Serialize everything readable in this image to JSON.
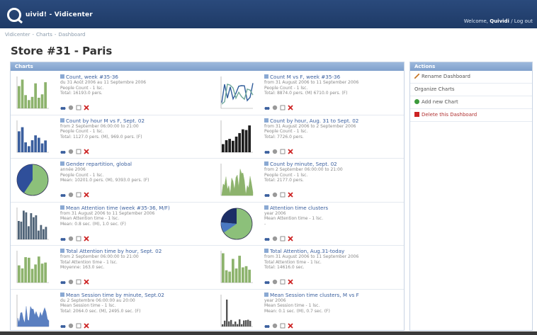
{
  "header": {
    "logo_text": "uivid! - Vidicenter",
    "welcome_prefix": "Welcome,",
    "user": "Quividi",
    "separator": "/",
    "logout": "Log out"
  },
  "breadcrumb": [
    "Vidicenter",
    "Charts",
    "Dashboard"
  ],
  "page_title": "Store #31 - Paris",
  "charts_panel": {
    "title": "Charts",
    "charts": [
      {
        "title": "Count, week #35-36",
        "lines": [
          "du 31 Août 2006 au 11 Septembre 2006",
          "People Count - 1 lsc.",
          "Total: 16193.0 pers."
        ],
        "thumb": "bar-green"
      },
      {
        "title": "Count M vs F, week #35-36",
        "lines": [
          "from 31 August 2006 to 11 September 2006",
          "People Count - 1 lsc.",
          "Total: 8874.0 pers. (M) 6710.0 pers. (F)"
        ],
        "thumb": "line-compare"
      },
      {
        "title": "Count by hour M vs F, Sept. 02",
        "lines": [
          "from 2 September 06:00:00 to 21:00",
          "People Count - 1 lsc.",
          "Total: 1127.0 pers. (M), 969.0 pers. (F)"
        ],
        "thumb": "bar-blue"
      },
      {
        "title": "Count by hour, Aug. 31 to Sept. 02",
        "lines": [
          "from 31 August 2006 to 2 September 2006",
          "People Count - 1 lsc.",
          "Total: 7726.0 pers."
        ],
        "thumb": "bar-dark"
      },
      {
        "title": "Gender repartition, global",
        "lines": [
          "année 2006",
          "People Count - 1 lsc.",
          "Mean: 10201.0 pers. (M), 9393.0 pers. (F)"
        ],
        "thumb": "pie-gender"
      },
      {
        "title": "Count by minute, Sept. 02",
        "lines": [
          "from 2 September 06:00:00 to 21:00",
          "People Count - 1 lsc.",
          "Total: 2177.0 pers."
        ],
        "thumb": "area-green"
      },
      {
        "title": "Mean Attention time (week #35-36, M/F)",
        "lines": [
          "from 31 August 2006 to 11 September 2006",
          "Mean Attention time - 1 lsc.",
          "Mean: 0.8 sec. (M), 1.0 sec. (F)"
        ],
        "thumb": "bar-slate"
      },
      {
        "title": "Attention time clusters",
        "lines": [
          "year 2006",
          "Mean Attention time - 1 lsc.",
          "-"
        ],
        "thumb": "pie-clusters"
      },
      {
        "title": "Total Attention time by hour, Sept. 02",
        "lines": [
          "from 2 September 06:00:00 to 21:00",
          "Total Attention time - 1 lsc.",
          "Moyenne: 163.0 sec."
        ],
        "thumb": "bar-green2"
      },
      {
        "title": "Total Attention, Aug.31-today",
        "lines": [
          "from 31 August 2006 to 11 September 2006",
          "Total Attention time - 1 lsc.",
          "Total: 14616.0 sec."
        ],
        "thumb": "bar-green3"
      },
      {
        "title": "Mean Session time by minute, Sept.02",
        "lines": [
          "du 2 Septembre 06:00:00 au 20:00",
          "Mean Session time - 1 lsc.",
          "Total: 2064.0 sec. (M), 2495.0 sec. (F)"
        ],
        "thumb": "area-blue"
      },
      {
        "title": "Mean Session time clusters, M vs F",
        "lines": [
          "year 2006",
          "Mean Session time - 1 lsc.",
          "Mean: 0.1 sec. (M), 0.7 sec. (F)"
        ],
        "thumb": "bar-sparse"
      }
    ]
  },
  "actions_panel": {
    "title": "Actions",
    "items": [
      {
        "label": "Rename Dashboard",
        "icon": "pencil-icon"
      },
      {
        "label": "Organize Charts",
        "icon": ""
      },
      {
        "label": "Add new Chart",
        "icon": "add-icon"
      },
      {
        "label": "Delete this Dashboard",
        "icon": "delete-icon"
      }
    ]
  },
  "colors": {
    "header": "#1e3a66",
    "panel_head": "#8aa9d3",
    "link": "#3a5f9e",
    "green": "#8db36d",
    "blue": "#3b5f9e",
    "delete": "#cc2222"
  }
}
